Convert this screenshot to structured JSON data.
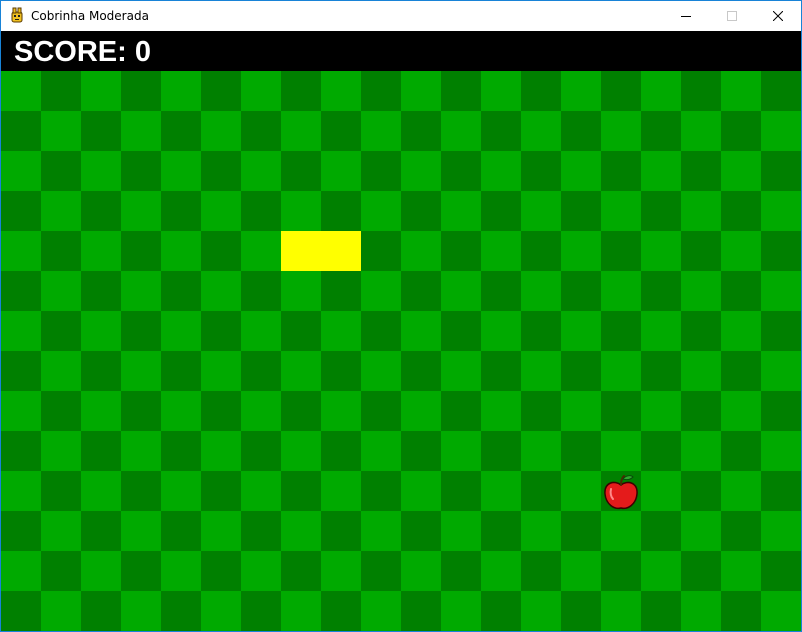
{
  "window": {
    "title": "Cobrinha Moderada",
    "icon": "pygame-snake-icon",
    "controls": [
      "minimize-icon",
      "maximize-icon",
      "close-icon"
    ]
  },
  "hud": {
    "score_text": "SCORE: 0"
  },
  "game": {
    "grid_cols": 20,
    "grid_rows": 14,
    "colors": {
      "tile_light": "#00aa00",
      "tile_dark": "#008000",
      "snake": "#ffff00",
      "hud_bg": "#000000",
      "hud_text": "#ffffff"
    },
    "snake": [
      {
        "col": 7,
        "row": 4
      },
      {
        "col": 8,
        "row": 4
      }
    ],
    "apple": {
      "col": 15,
      "row": 10,
      "icon": "apple-icon"
    }
  }
}
